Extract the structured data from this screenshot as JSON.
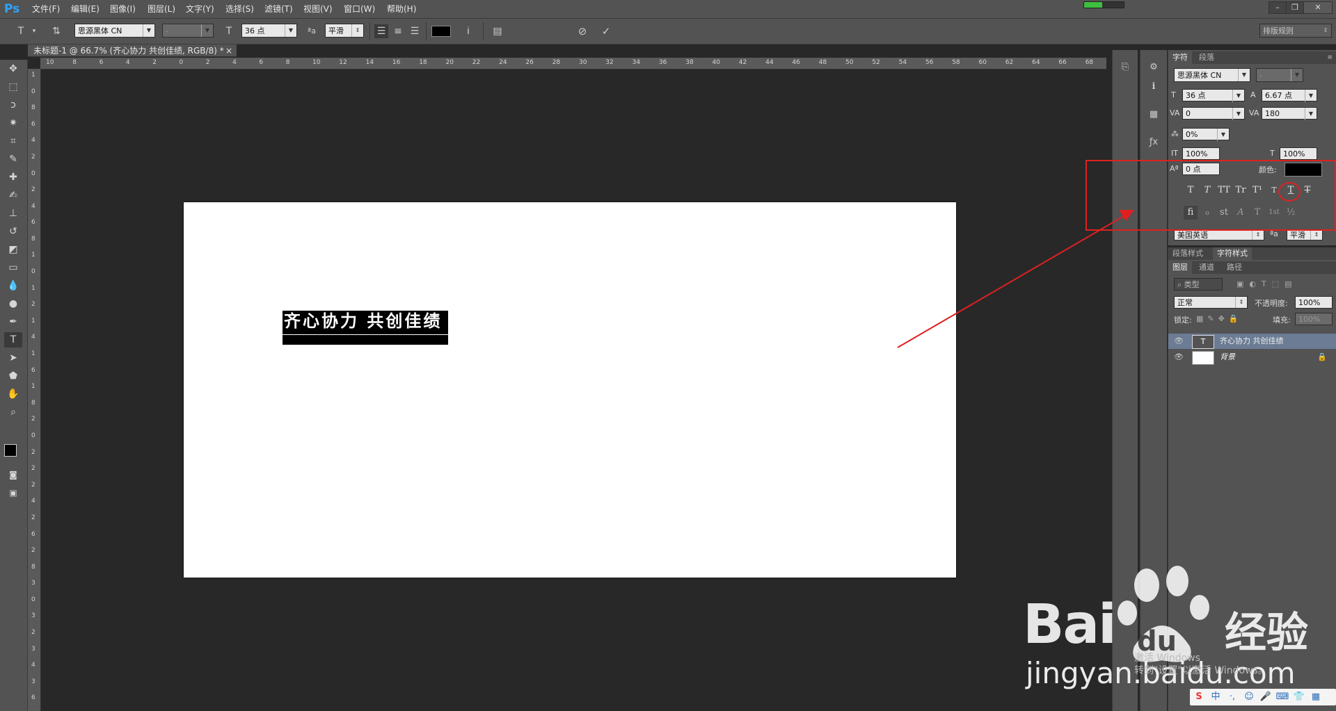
{
  "app": {
    "logo": "Ps",
    "colors": {
      "accent": "#2fa3ff",
      "annotation": "#e02020",
      "progress": "#3fbf3f"
    }
  },
  "menu": [
    "文件(F)",
    "编辑(E)",
    "图像(I)",
    "图层(L)",
    "文字(Y)",
    "选择(S)",
    "滤镜(T)",
    "视图(V)",
    "窗口(W)",
    "帮助(H)"
  ],
  "window_controls": {
    "minimize": "–",
    "restore": "❐",
    "close": "✕"
  },
  "progress_fraction": 0.45,
  "options": {
    "font_family": "思源黑体 CN",
    "font_style": "-",
    "font_size": "36 点",
    "aa_label": "ªa",
    "antialias": "平滑",
    "workspace": "排版规则",
    "color_hex": "#000000"
  },
  "document": {
    "tab_title": "未标题-1 @ 66.7% (齐心协力 共创佳绩, RGB/8) *",
    "tab_close": "×",
    "text_layer_content": "齐心协力 共创佳绩"
  },
  "rulers": {
    "h_labels": [
      "10",
      "8",
      "6",
      "4",
      "2",
      "0",
      "2",
      "4",
      "6",
      "8",
      "10",
      "12",
      "14",
      "16",
      "18",
      "20",
      "22",
      "24",
      "26",
      "28",
      "30",
      "32",
      "34",
      "36",
      "38",
      "40",
      "42",
      "44",
      "46",
      "48",
      "50",
      "52",
      "54",
      "56",
      "58",
      "60",
      "62",
      "64",
      "66",
      "68"
    ],
    "v_labels": [
      "1",
      "0",
      "8",
      "6",
      "4",
      "2",
      "0",
      "2",
      "4",
      "6",
      "8",
      "1",
      "0",
      "1",
      "2",
      "1",
      "4",
      "1",
      "6",
      "1",
      "8",
      "2",
      "0",
      "2",
      "2",
      "2",
      "4",
      "2",
      "6",
      "2",
      "8",
      "3",
      "0",
      "3",
      "2",
      "3",
      "4",
      "3",
      "6"
    ]
  },
  "character_panel": {
    "tabs": [
      "字符",
      "段落"
    ],
    "font_family": "思源黑体 CN",
    "font_style": "-",
    "size": "36 点",
    "leading": "6.67 点",
    "kerning": "0",
    "tracking": "180",
    "tsume": "0%",
    "vscale": "100%",
    "hscale": "100%",
    "baseline": "0 点",
    "color_label": "颜色:",
    "style_buttons": [
      "T",
      "T",
      "TT",
      "Tr",
      "T¹",
      "T",
      "T",
      "T"
    ],
    "opentype_buttons": [
      "fi",
      "ℴ",
      "st",
      "A",
      "T",
      "1st",
      "½"
    ],
    "language": "美国英语",
    "aa_label": "ªa",
    "antialias": "平滑"
  },
  "style_tabs": [
    "段落样式",
    "字符样式"
  ],
  "layers_panel": {
    "tabs": [
      "图层",
      "通道",
      "路径"
    ],
    "filter": "类型",
    "blend_mode": "正常",
    "opacity_label": "不透明度:",
    "opacity": "100%",
    "lock_label": "锁定:",
    "fill_label": "填充:",
    "fill": "100%",
    "layers": [
      {
        "name": "齐心协力 共创佳绩",
        "type": "text",
        "selected": true
      },
      {
        "name": "背景",
        "type": "background",
        "locked": true
      }
    ]
  },
  "watermark": {
    "brand": "Bai",
    "du": "du",
    "suffix": "经验",
    "url": "jingyan.baidu.com"
  },
  "os_notice": {
    "line1": "激活 Windows",
    "line2": "转到\"设置\"以激活 Windows。"
  },
  "tray": {
    "ime": "中"
  }
}
